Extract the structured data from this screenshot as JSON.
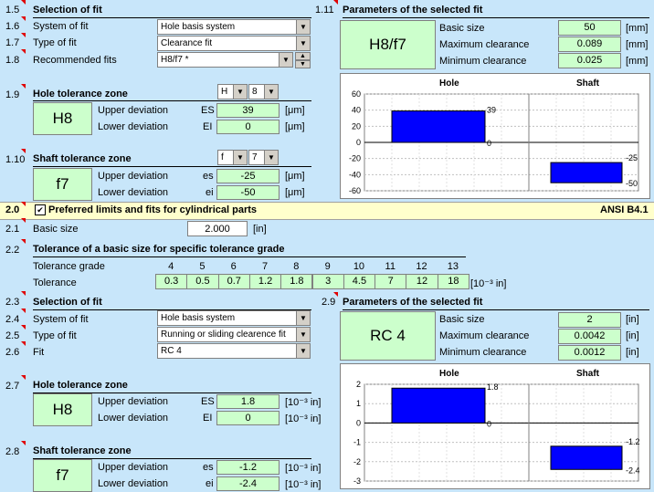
{
  "metric": {
    "num_selection": "1.5",
    "selection_title": "Selection of fit",
    "num_system": "1.6",
    "system_label": "System of fit",
    "system_value": "Hole basis system",
    "num_type": "1.7",
    "type_label": "Type of fit",
    "type_value": "Clearance fit",
    "num_recommended": "1.8",
    "recommended_label": "Recommended fits",
    "recommended_value": "H8/f7 *",
    "num_params": "1.11",
    "params_title": "Parameters of the selected fit",
    "fit_name": "H8/f7",
    "basic_size_label": "Basic size",
    "basic_size_value": "50",
    "basic_size_unit": "[mm]",
    "max_clear_label": "Maximum clearance",
    "max_clear_value": "0.089",
    "max_clear_unit": "[mm]",
    "min_clear_label": "Minimum clearance",
    "min_clear_value": "0.025",
    "min_clear_unit": "[mm]",
    "num_hole": "1.9",
    "hole_title": "Hole tolerance zone",
    "hole_letter": "H",
    "hole_grade": "8",
    "hole_name": "H8",
    "upper_dev_label": "Upper deviation",
    "lower_dev_label": "Lower deviation",
    "ES": "ES",
    "EI": "EI",
    "hole_es": "39",
    "hole_ei": "0",
    "unit_um": "[μm]",
    "num_shaft": "1.10",
    "shaft_title": "Shaft tolerance zone",
    "shaft_letter": "f",
    "shaft_grade": "7",
    "shaft_name": "f7",
    "es": "es",
    "ei": "ei",
    "shaft_es": "-25",
    "shaft_ei": "-50"
  },
  "banner": {
    "num": "2.0",
    "title": "Preferred limits and fits for cylindrical parts",
    "standard": "ANSI B4.1"
  },
  "imperial": {
    "num_basic": "2.1",
    "basic_label": "Basic size",
    "basic_value": "2.000",
    "basic_unit": "[in]",
    "num_tol": "2.2",
    "tol_title": "Tolerance of a basic size for specific tolerance grade",
    "grade_label": "Tolerance grade",
    "tolerance_label": "Tolerance",
    "tol_unit": "[10⁻³ in]",
    "num_selection": "2.3",
    "selection_title": "Selection of fit",
    "num_system": "2.4",
    "system_label": "System of fit",
    "system_value": "Hole basis system",
    "num_type": "2.5",
    "type_label": "Type of fit",
    "type_value": "Running or sliding clearence fit",
    "num_fit": "2.6",
    "fit_label": "Fit",
    "fit_value": "RC 4",
    "num_params": "2.9",
    "params_title": "Parameters of the selected fit",
    "fit_name": "RC 4",
    "basic_size_label": "Basic size",
    "basic_size_value": "2",
    "basic_size_unit": "[in]",
    "max_clear_label": "Maximum clearance",
    "max_clear_value": "0.0042",
    "max_clear_unit": "[in]",
    "min_clear_label": "Minimum clearance",
    "min_clear_value": "0.0012",
    "min_clear_unit": "[in]",
    "num_hole": "2.7",
    "hole_title": "Hole tolerance zone",
    "hole_name": "H8",
    "upper_dev_label": "Upper deviation",
    "lower_dev_label": "Lower deviation",
    "ES": "ES",
    "EI": "EI",
    "hole_es": "1.8",
    "hole_ei": "0",
    "unit_e3in": "[10⁻³ in]",
    "num_shaft": "2.8",
    "shaft_title": "Shaft tolerance zone",
    "shaft_name": "f7",
    "es": "es",
    "ei": "ei",
    "shaft_es": "-1.2",
    "shaft_ei": "-2.4"
  },
  "grades": [
    "4",
    "5",
    "6",
    "7",
    "8",
    "9",
    "10",
    "11",
    "12",
    "13"
  ],
  "tolerances": [
    "0.3",
    "0.5",
    "0.7",
    "1.2",
    "1.8",
    "3",
    "4.5",
    "7",
    "12",
    "18"
  ],
  "chart_data": [
    {
      "type": "bar",
      "categories": [
        "Hole",
        "Shaft"
      ],
      "ylim": [
        -60,
        60
      ],
      "yticks": [
        "60",
        "40",
        "20",
        "0",
        "-20",
        "-40",
        "-60"
      ],
      "bars": [
        {
          "category": "Hole",
          "upper": 39,
          "lower": 0,
          "upper_label": "39",
          "lower_label": "0"
        },
        {
          "category": "Shaft",
          "upper": -25,
          "lower": -50,
          "upper_label": "-25",
          "lower_label": "-50"
        }
      ],
      "bar_color": "#0000ff",
      "grid": true
    },
    {
      "type": "bar",
      "categories": [
        "Hole",
        "Shaft"
      ],
      "ylim": [
        -3,
        2
      ],
      "yticks": [
        "2",
        "1",
        "0",
        "-1",
        "-2",
        "-3"
      ],
      "bars": [
        {
          "category": "Hole",
          "upper": 1.8,
          "lower": 0,
          "upper_label": "1.8",
          "lower_label": "0"
        },
        {
          "category": "Shaft",
          "upper": -1.2,
          "lower": -2.4,
          "upper_label": "-1.2",
          "lower_label": "-2.4"
        }
      ],
      "bar_color": "#0000ff",
      "grid": true
    }
  ]
}
